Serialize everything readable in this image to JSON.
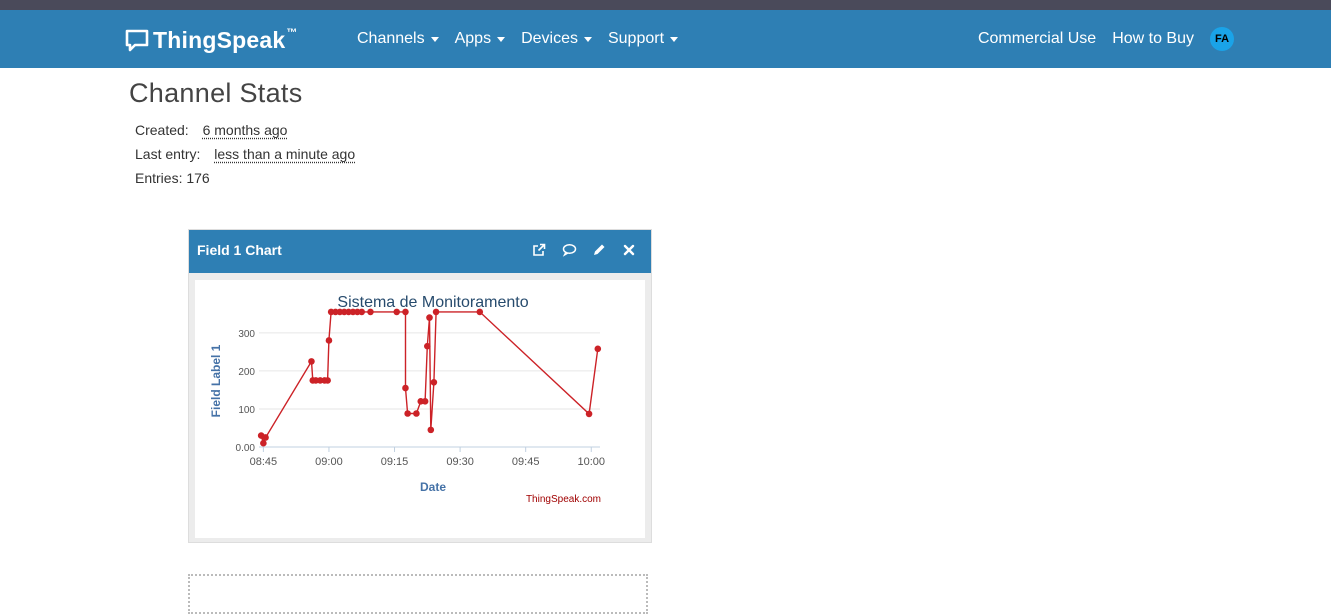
{
  "nav": {
    "brand": "ThingSpeak",
    "brand_tm": "™",
    "menus": [
      "Channels",
      "Apps",
      "Devices",
      "Support"
    ],
    "links": [
      "Commercial Use",
      "How to Buy"
    ],
    "avatar_initials": "FA"
  },
  "page": {
    "title": "Channel Stats",
    "created_label": "Created:",
    "created_value": "6 months ago",
    "last_entry_label": "Last entry:",
    "last_entry_value": "less than a minute ago",
    "entries_text": "Entries: 176"
  },
  "panel": {
    "title": "Field 1 Chart",
    "tool_icons": [
      "external-link-icon",
      "comment-icon",
      "pencil-icon",
      "close-icon"
    ]
  },
  "chart_data": {
    "type": "line",
    "title": "Sistema de Monitoramento",
    "xlabel": "Date",
    "ylabel": "Field Label 1",
    "credit": "ThingSpeak.com",
    "x_ticks": [
      "08:45",
      "09:00",
      "09:15",
      "09:30",
      "09:45",
      "10:00"
    ],
    "y_ticks": [
      "0.00",
      "100",
      "200",
      "300"
    ],
    "ylim": [
      0,
      360
    ],
    "xlim": [
      "08:44",
      "10:02"
    ],
    "grid": true,
    "color": "#cc2227",
    "points": [
      {
        "x": "08:44.5",
        "y": 30
      },
      {
        "x": "08:45",
        "y": 10
      },
      {
        "x": "08:45.5",
        "y": 25
      },
      {
        "x": "08:56",
        "y": 225
      },
      {
        "x": "08:56.3",
        "y": 175
      },
      {
        "x": "08:57",
        "y": 175
      },
      {
        "x": "08:58",
        "y": 175
      },
      {
        "x": "08:59",
        "y": 175
      },
      {
        "x": "08:59.7",
        "y": 175
      },
      {
        "x": "09:00",
        "y": 280
      },
      {
        "x": "09:00.5",
        "y": 355
      },
      {
        "x": "09:01.5",
        "y": 355
      },
      {
        "x": "09:02.5",
        "y": 355
      },
      {
        "x": "09:03.5",
        "y": 355
      },
      {
        "x": "09:04.5",
        "y": 355
      },
      {
        "x": "09:05.5",
        "y": 355
      },
      {
        "x": "09:06.5",
        "y": 355
      },
      {
        "x": "09:07.5",
        "y": 355
      },
      {
        "x": "09:09.5",
        "y": 355
      },
      {
        "x": "09:15.5",
        "y": 355
      },
      {
        "x": "09:17.5",
        "y": 355
      },
      {
        "x": "09:17.5",
        "y": 155
      },
      {
        "x": "09:18",
        "y": 88
      },
      {
        "x": "09:20",
        "y": 88
      },
      {
        "x": "09:21",
        "y": 120
      },
      {
        "x": "09:22",
        "y": 120
      },
      {
        "x": "09:22.5",
        "y": 265
      },
      {
        "x": "09:23",
        "y": 340
      },
      {
        "x": "09:23.3",
        "y": 45
      },
      {
        "x": "09:24",
        "y": 170
      },
      {
        "x": "09:24.5",
        "y": 355
      },
      {
        "x": "09:34.5",
        "y": 355
      },
      {
        "x": "09:59.5",
        "y": 87
      },
      {
        "x": "10:01.5",
        "y": 258
      }
    ]
  }
}
